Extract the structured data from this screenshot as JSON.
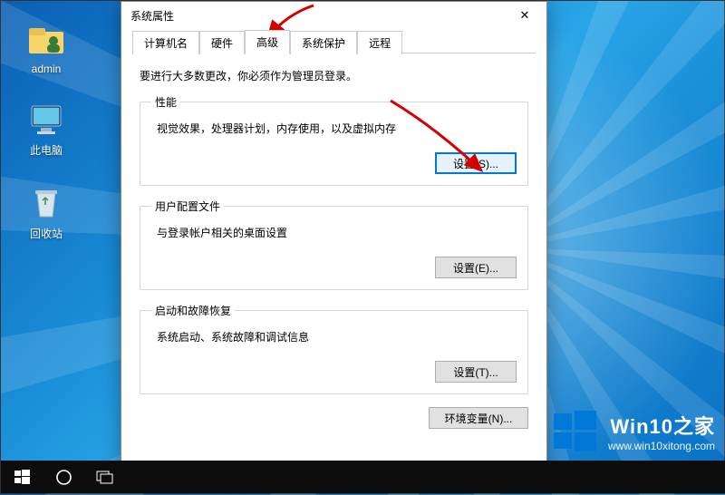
{
  "desktop": {
    "icons": [
      {
        "label": "admin"
      },
      {
        "label": "此电脑"
      },
      {
        "label": "回收站"
      }
    ]
  },
  "dialog": {
    "title": "系统属性",
    "close_glyph": "✕",
    "tabs": [
      {
        "label": "计算机名"
      },
      {
        "label": "硬件"
      },
      {
        "label": "高级"
      },
      {
        "label": "系统保护"
      },
      {
        "label": "远程"
      }
    ],
    "info": "要进行大多数更改，你必须作为管理员登录。",
    "groups": {
      "performance": {
        "legend": "性能",
        "desc": "视觉效果，处理器计划，内存使用，以及虚拟内存",
        "button": "设置(S)..."
      },
      "profiles": {
        "legend": "用户配置文件",
        "desc": "与登录帐户相关的桌面设置",
        "button": "设置(E)..."
      },
      "startup": {
        "legend": "启动和故障恢复",
        "desc": "系统启动、系统故障和调试信息",
        "button": "设置(T)..."
      }
    },
    "env_button": "环境变量(N)..."
  },
  "watermark": {
    "brand": "Win10之家",
    "url": "www.win10xitong.com"
  }
}
